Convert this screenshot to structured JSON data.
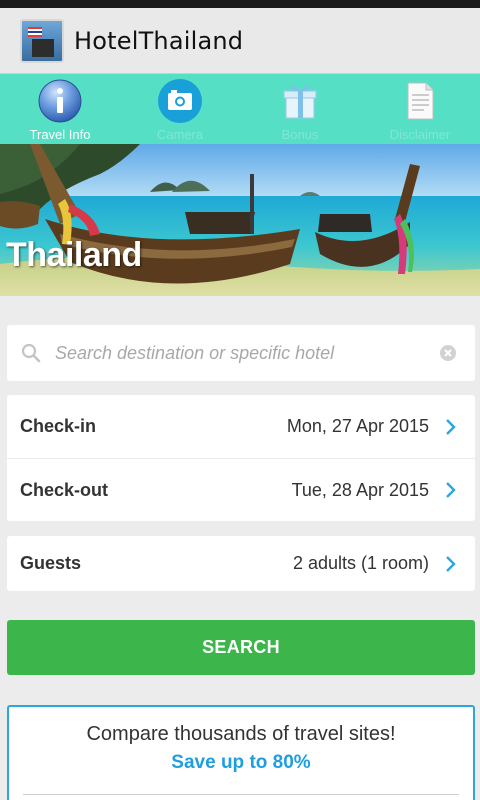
{
  "app": {
    "title": "HotelThailand"
  },
  "tabs": [
    {
      "label": "Travel Info",
      "icon": "info-icon"
    },
    {
      "label": "Camera",
      "icon": "camera-icon"
    },
    {
      "label": "Bonus",
      "icon": "gift-icon"
    },
    {
      "label": "Disclaimer",
      "icon": "document-icon"
    }
  ],
  "hero": {
    "title": "Thailand"
  },
  "search": {
    "placeholder": "Search destination or specific hotel"
  },
  "checkin": {
    "label": "Check-in",
    "value": "Mon, 27 Apr 2015"
  },
  "checkout": {
    "label": "Check-out",
    "value": "Tue, 28 Apr 2015"
  },
  "guests": {
    "label": "Guests",
    "value": "2 adults (1 room)"
  },
  "search_button": {
    "label": "SEARCH"
  },
  "promo": {
    "line1": "Compare thousands of travel sites!",
    "line2": "Save up to 80%"
  },
  "colors": {
    "accent": "#55e0c6",
    "button": "#3cb54a",
    "link": "#1f9fe0",
    "chevron": "#2ba6de"
  }
}
